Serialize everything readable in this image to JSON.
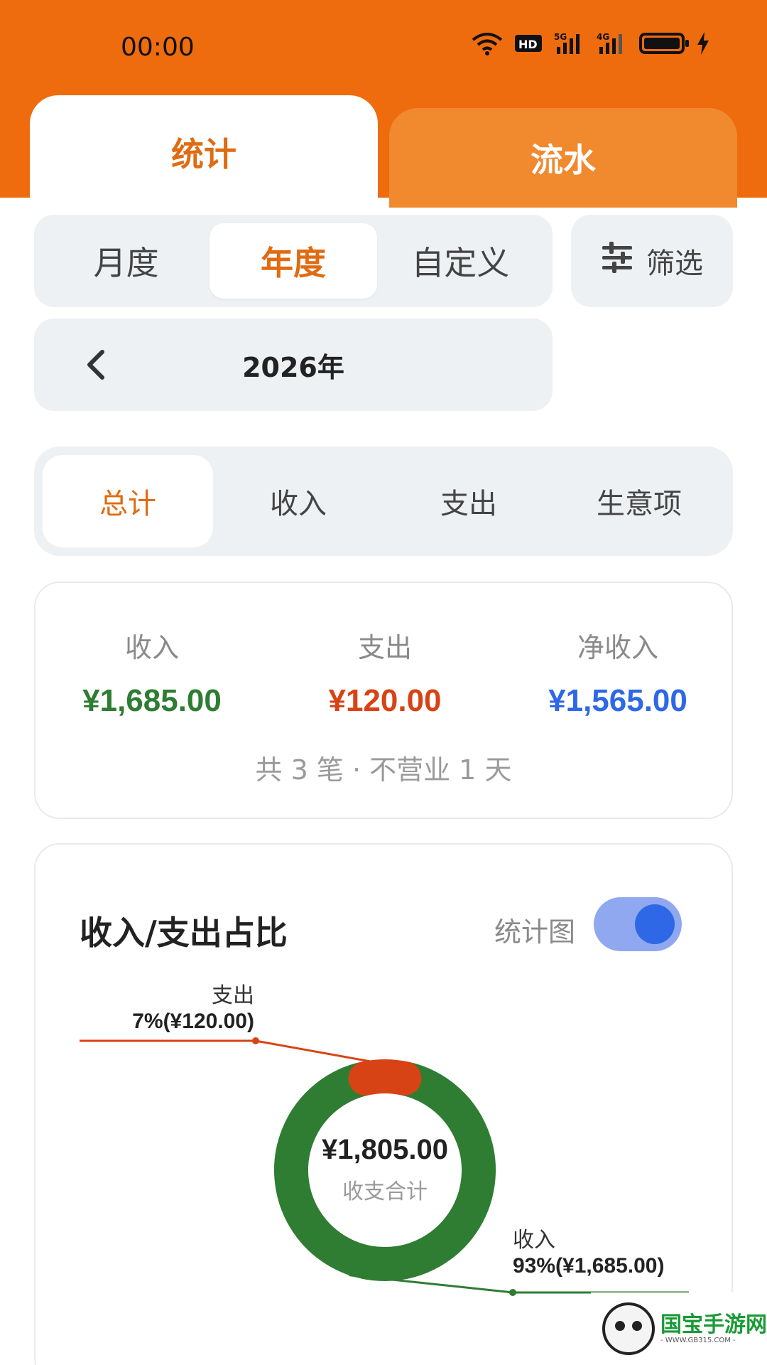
{
  "status_bar": {
    "time": "00:00",
    "icons": [
      "wifi-icon",
      "hd-icon",
      "5g-signal-icon",
      "4g-signal-icon",
      "battery-icon",
      "charging-icon"
    ]
  },
  "top_tabs": [
    {
      "label": "统计"
    },
    {
      "label": "流水"
    }
  ],
  "period": {
    "options": [
      "月度",
      "年度",
      "自定义"
    ],
    "selected": "年度"
  },
  "filter": {
    "label": "筛选"
  },
  "year_nav": {
    "label": "2026年"
  },
  "category_tabs": {
    "items": [
      "总计",
      "收入",
      "支出",
      "生意项"
    ],
    "selected": "总计"
  },
  "summary": {
    "income_label": "收入",
    "income_value": "¥1,685.00",
    "expense_label": "支出",
    "expense_value": "¥120.00",
    "net_label": "净收入",
    "net_value": "¥1,565.00",
    "footer": "共 3 笔 · 不营业 1 天"
  },
  "chart_section": {
    "title": "收入/支出占比",
    "toggle_label": "统计图",
    "toggle_on": true,
    "center_value": "¥1,805.00",
    "center_label": "收支合计"
  },
  "chart_data": {
    "type": "pie",
    "categories": [
      "收入",
      "支出"
    ],
    "values": [
      1685.0,
      120.0
    ],
    "percents": [
      93,
      7
    ],
    "labels": [
      "93%(¥1,685.00)",
      "7%(¥120.00)"
    ],
    "colors": [
      "#2e7d32",
      "#d84315"
    ],
    "total": 1805.0
  },
  "colors": {
    "accent": "#ee6c0e",
    "income": "#2e7d32",
    "expense": "#d84315",
    "net": "#2e68e6"
  },
  "watermark": {
    "text": "国宝手游网",
    "sub": "- WWW.GB315.COM -"
  }
}
